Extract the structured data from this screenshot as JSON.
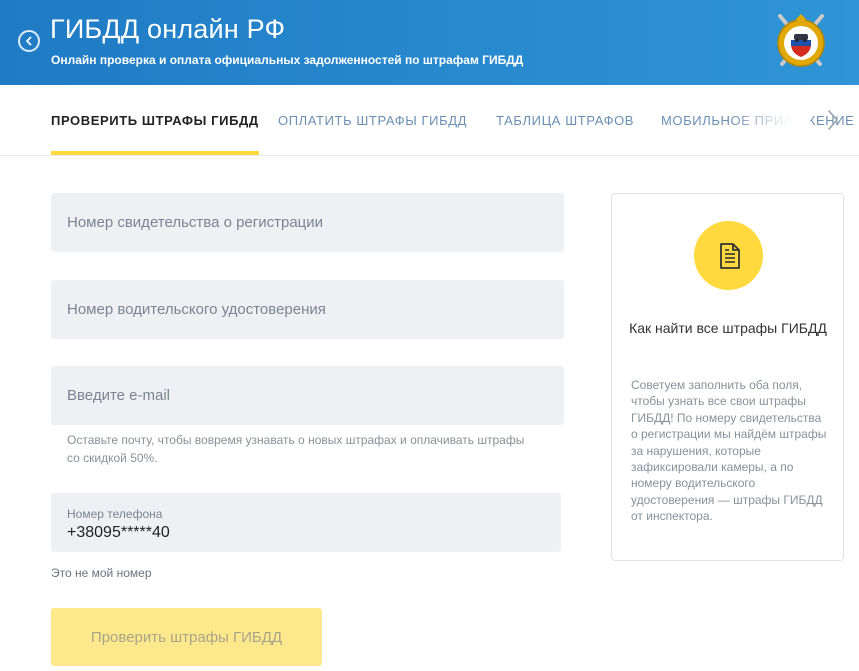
{
  "header": {
    "title": "ГИБДД онлайн РФ",
    "subtitle": "Онлайн проверка и оплата официальных задолженностей по штрафам ГИБДД",
    "emblem_icon": "gibdd-emblem-icon",
    "back_icon": "chevron-left-icon",
    "background_color": "#2a8bd0"
  },
  "tabs": [
    {
      "label": "Проверить штрафы ГИБДД",
      "active": true
    },
    {
      "label": "Оплатить штрафы ГИБДД",
      "active": false
    },
    {
      "label": "Таблица штрафов",
      "active": false
    },
    {
      "label": "Мобильное приложение",
      "active": false
    }
  ],
  "form": {
    "registration_placeholder": "Номер свидетельства о регистрации",
    "license_placeholder": "Номер водительского удостоверения",
    "email_placeholder": "Введите e-mail",
    "email_hint": "Оставьте почту, чтобы вовремя узнавать о новых штрафах и оплачивать штрафы со скидкой 50%.",
    "phone_label": "Номер телефона",
    "phone_value": "+38095*****40",
    "not_my_number": "Это не мой номер",
    "submit_label": "Проверить штрафы ГИБДД"
  },
  "info_card": {
    "icon": "document-icon",
    "title": "Как найти все штрафы ГИБДД",
    "text": "Советуем заполнить оба поля, чтобы узнать все свои штрафы ГИБДД! По номеру свидетельства о регистрации мы найдём штрафы за нарушения, которые зафиксировали камеры, а по номеру водительского удостоверения — штрафы ГИБДД от инспектора."
  },
  "colors": {
    "accent_yellow": "#ffd93d",
    "tab_inactive": "#6b8fb3",
    "field_bg": "#eef0f4"
  }
}
